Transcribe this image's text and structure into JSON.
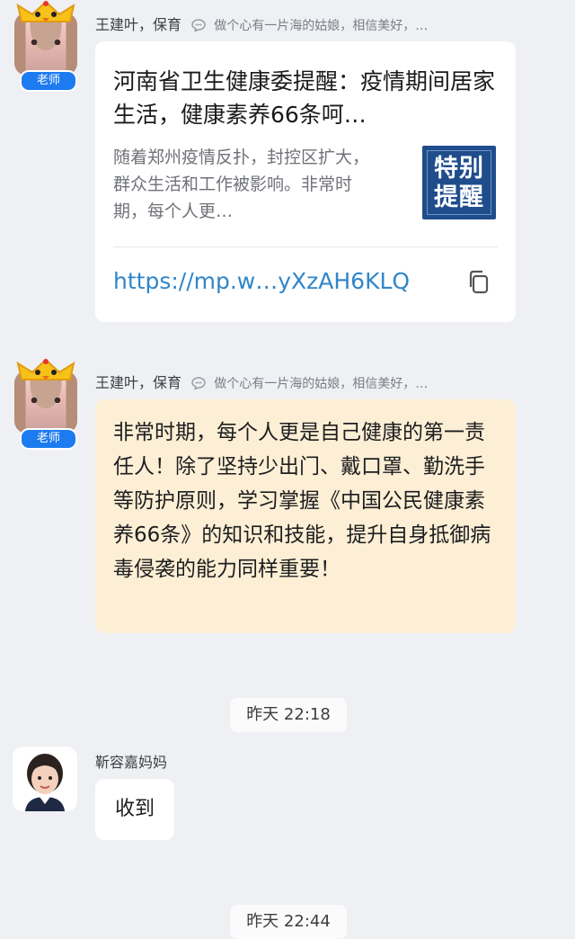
{
  "messages": [
    {
      "sender_name": "王建叶，保育",
      "signature": "做个心有一片海的姑娘，相信美好，…",
      "role_badge": "老师",
      "card": {
        "title": "河南省卫生健康委提醒：疫情期间居家生活，健康素养66条呵…",
        "description": "随着郑州疫情反扑，封控区扩大，群众生活和工作被影响。非常时期，每个人更…",
        "thumbnail_text": "特别提醒",
        "link": "https://mp.w…yXzAH6KLQ"
      }
    },
    {
      "sender_name": "王建叶，保育",
      "signature": "做个心有一片海的姑娘，相信美好，…",
      "role_badge": "老师",
      "text": "非常时期，每个人更是自己健康的第一责任人！除了坚持少出门、戴口罩、勤洗手等防护原则，学习掌握《中国公民健康素养66条》的知识和技能，提升自身抵御病毒侵袭的能力同样重要！"
    },
    {
      "timestamp": "昨天 22:18"
    },
    {
      "sender_name": "靳容嘉妈妈",
      "text": "收到"
    },
    {
      "timestamp": "昨天 22:44"
    }
  ],
  "colors": {
    "background": "#eef0f4",
    "badge": "#1d7bf0",
    "link": "#2f86c9",
    "highlight_bubble": "#fcefd5",
    "thumbnail": "#1f4d8c"
  },
  "icons": [
    "chat-bubble-icon",
    "copy-icon",
    "crown-icon"
  ]
}
